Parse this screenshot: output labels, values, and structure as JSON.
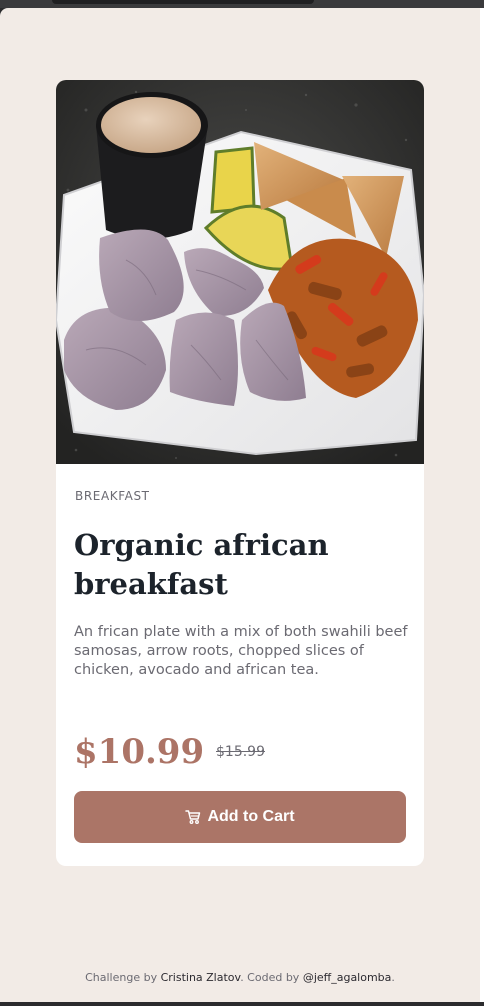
{
  "product": {
    "category": "BREAKFAST",
    "title": "Organic african breakfast",
    "description": "An frican plate with a mix of both swahili beef samosas, arrow roots, chopped slices of chicken, avocado and african tea.",
    "price": "$10.99",
    "old_price": "$15.99",
    "image_alt": "Plate with samosas, arrow roots, avocado, chicken and a cup of tea"
  },
  "cart_button": {
    "label": "Add to Cart",
    "icon": "cart-icon"
  },
  "footer": {
    "prefix": "Challenge by",
    "challenge_author": "Cristina Zlatov",
    "middle": ". Coded by",
    "coder": "@jeff_agalomba",
    "suffix": "."
  },
  "colors": {
    "page_bg": "#f2ebe6",
    "card_bg": "#ffffff",
    "accent": "#ab7567",
    "heading": "#1c232b",
    "body_text": "#6b6a72"
  }
}
